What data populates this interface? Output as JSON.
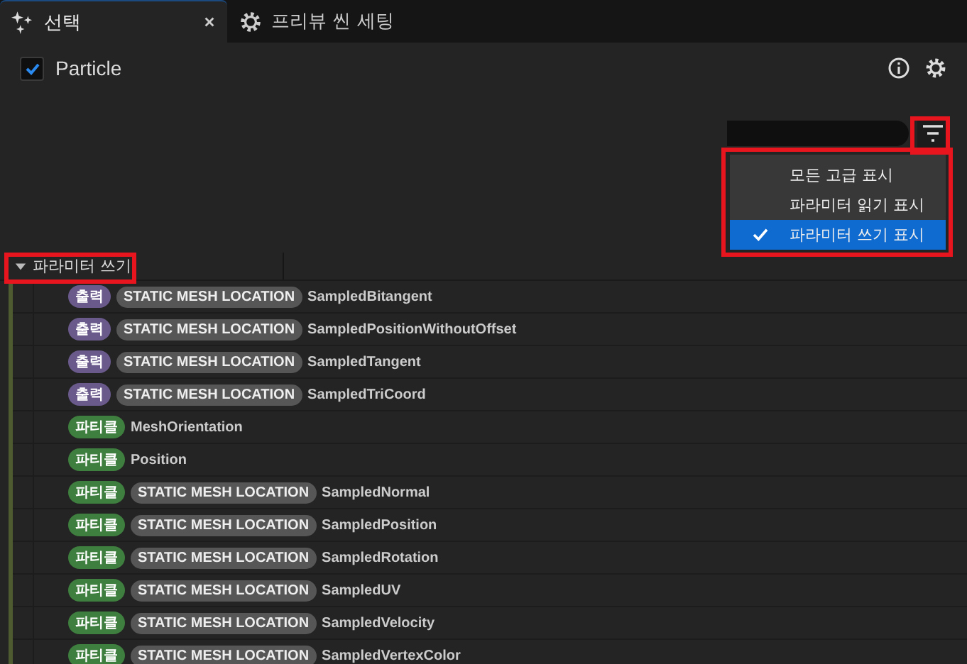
{
  "tabs": [
    {
      "label": "선택",
      "selected": true,
      "kind": "selection"
    },
    {
      "label": "프리뷰 씬 세팅",
      "selected": false,
      "kind": "preview"
    }
  ],
  "header": {
    "title": "Particle",
    "checked": true
  },
  "filter_menu": {
    "items": [
      {
        "label": "모든 고급 표시",
        "selected": false
      },
      {
        "label": "파라미터 읽기 표시",
        "selected": false
      },
      {
        "label": "파라미터 쓰기 표시",
        "selected": true
      }
    ]
  },
  "section": {
    "label": "파라미터 쓰기",
    "expanded": true
  },
  "rows": [
    {
      "scope": "출력",
      "kind": "output",
      "type": "STATIC MESH LOCATION",
      "name": "SampledBitangent"
    },
    {
      "scope": "출력",
      "kind": "output",
      "type": "STATIC MESH LOCATION",
      "name": "SampledPositionWithoutOffset"
    },
    {
      "scope": "출력",
      "kind": "output",
      "type": "STATIC MESH LOCATION",
      "name": "SampledTangent"
    },
    {
      "scope": "출력",
      "kind": "output",
      "type": "STATIC MESH LOCATION",
      "name": "SampledTriCoord"
    },
    {
      "scope": "파티클",
      "kind": "particle",
      "name": "MeshOrientation"
    },
    {
      "scope": "파티클",
      "kind": "particle",
      "name": "Position"
    },
    {
      "scope": "파티클",
      "kind": "particle",
      "type": "STATIC MESH LOCATION",
      "name": "SampledNormal"
    },
    {
      "scope": "파티클",
      "kind": "particle",
      "type": "STATIC MESH LOCATION",
      "name": "SampledPosition"
    },
    {
      "scope": "파티클",
      "kind": "particle",
      "type": "STATIC MESH LOCATION",
      "name": "SampledRotation"
    },
    {
      "scope": "파티클",
      "kind": "particle",
      "type": "STATIC MESH LOCATION",
      "name": "SampledUV"
    },
    {
      "scope": "파티클",
      "kind": "particle",
      "type": "STATIC MESH LOCATION",
      "name": "SampledVelocity"
    },
    {
      "scope": "파티클",
      "kind": "particle",
      "type": "STATIC MESH LOCATION",
      "name": "SampledVertexColor"
    }
  ]
}
